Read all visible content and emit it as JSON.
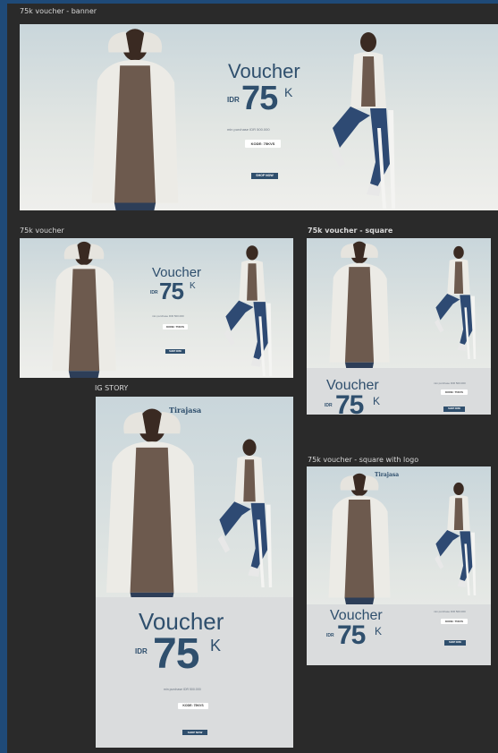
{
  "frames": {
    "banner": {
      "label": "75k voucher - banner"
    },
    "voucher": {
      "label": "75k voucher"
    },
    "square": {
      "label": "75k voucher - square"
    },
    "story": {
      "label": "IG STORY"
    },
    "square_logo": {
      "label": "75k voucher - square with logo"
    }
  },
  "ad": {
    "headline": "Voucher",
    "currency": "IDR",
    "amount": "75",
    "suffix": "K",
    "fine_print": "min purchase IDR 500.000",
    "code": "KODE: 75KVS",
    "cta": "SHOP NOW",
    "brand": "Tirajasa"
  },
  "colors": {
    "canvas": "#2a2a2a",
    "accent": "#2f4f6d",
    "panel": "#dadcdd",
    "outer": "#1f4a78"
  }
}
